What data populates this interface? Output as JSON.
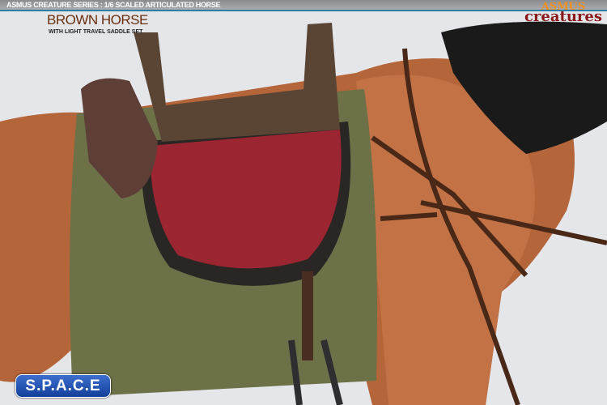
{
  "header": {
    "series": "ASMUS CREATURE SERIES : 1/6 SCALED ARTICULATED HORSE",
    "title": "BROWN HORSE",
    "subtitle": "WITH LIGHT TRAVEL SADDLE SET"
  },
  "brand_logo": {
    "line1": "ASMUS",
    "line2": "creatures"
  },
  "retailer_logo": {
    "text": "S.P.A.C.E"
  }
}
